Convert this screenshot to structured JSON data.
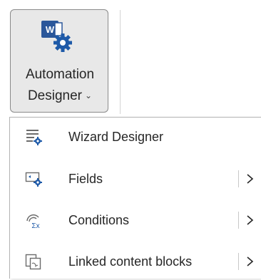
{
  "ribbon": {
    "button": {
      "label_line1": "Automation",
      "label_line2": "Designer",
      "chevron": "⌄",
      "icon": "word-gear-icon"
    }
  },
  "menu": {
    "items": [
      {
        "label": "Wizard Designer",
        "icon": "wizard-designer-icon",
        "has_submenu": false
      },
      {
        "label": "Fields",
        "icon": "fields-icon",
        "has_submenu": true
      },
      {
        "label": "Conditions",
        "icon": "conditions-icon",
        "has_submenu": true
      },
      {
        "label": "Linked content blocks",
        "icon": "linked-content-blocks-icon",
        "has_submenu": true
      }
    ]
  },
  "colors": {
    "word_blue": "#2b579a",
    "gear_blue": "#1e5aa8",
    "icon_gray": "#6b6b6b"
  }
}
